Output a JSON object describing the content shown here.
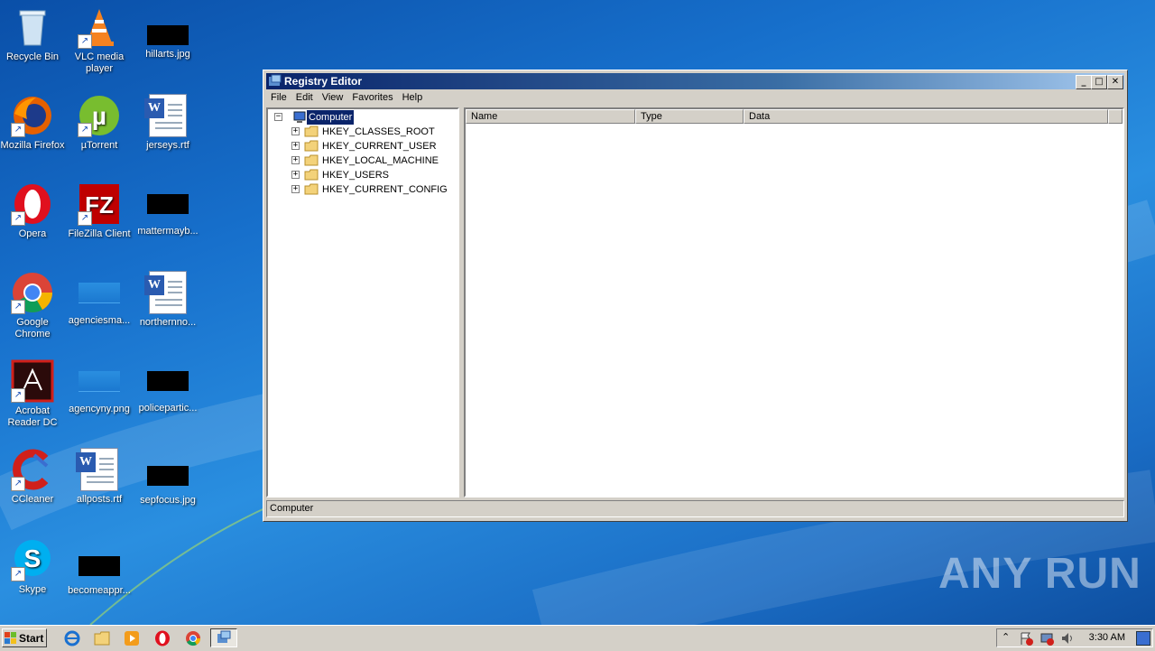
{
  "desktop": {
    "icons": [
      {
        "label": "Recycle Bin"
      },
      {
        "label": "VLC media player"
      },
      {
        "label": "hillarts.jpg"
      },
      {
        "label": "Mozilla Firefox"
      },
      {
        "label": "µTorrent"
      },
      {
        "label": "jerseys.rtf"
      },
      {
        "label": "Opera"
      },
      {
        "label": "FileZilla Client"
      },
      {
        "label": "mattermayb..."
      },
      {
        "label": "Google Chrome"
      },
      {
        "label": "agenciesma..."
      },
      {
        "label": "northernno..."
      },
      {
        "label": "Acrobat Reader DC"
      },
      {
        "label": "agencyny.png"
      },
      {
        "label": "policepartic..."
      },
      {
        "label": "CCleaner"
      },
      {
        "label": "allposts.rtf"
      },
      {
        "label": "sepfocus.jpg"
      },
      {
        "label": "Skype"
      },
      {
        "label": "becomeappr..."
      }
    ]
  },
  "window": {
    "title": "Registry Editor",
    "menu": [
      "File",
      "Edit",
      "View",
      "Favorites",
      "Help"
    ],
    "tree": {
      "root": "Computer",
      "children": [
        "HKEY_CLASSES_ROOT",
        "HKEY_CURRENT_USER",
        "HKEY_LOCAL_MACHINE",
        "HKEY_USERS",
        "HKEY_CURRENT_CONFIG"
      ]
    },
    "columns": [
      "Name",
      "Type",
      "Data"
    ],
    "status": "Computer"
  },
  "taskbar": {
    "start_label": "Start",
    "clock": "3:30 AM"
  },
  "watermark": "ANY RUN"
}
